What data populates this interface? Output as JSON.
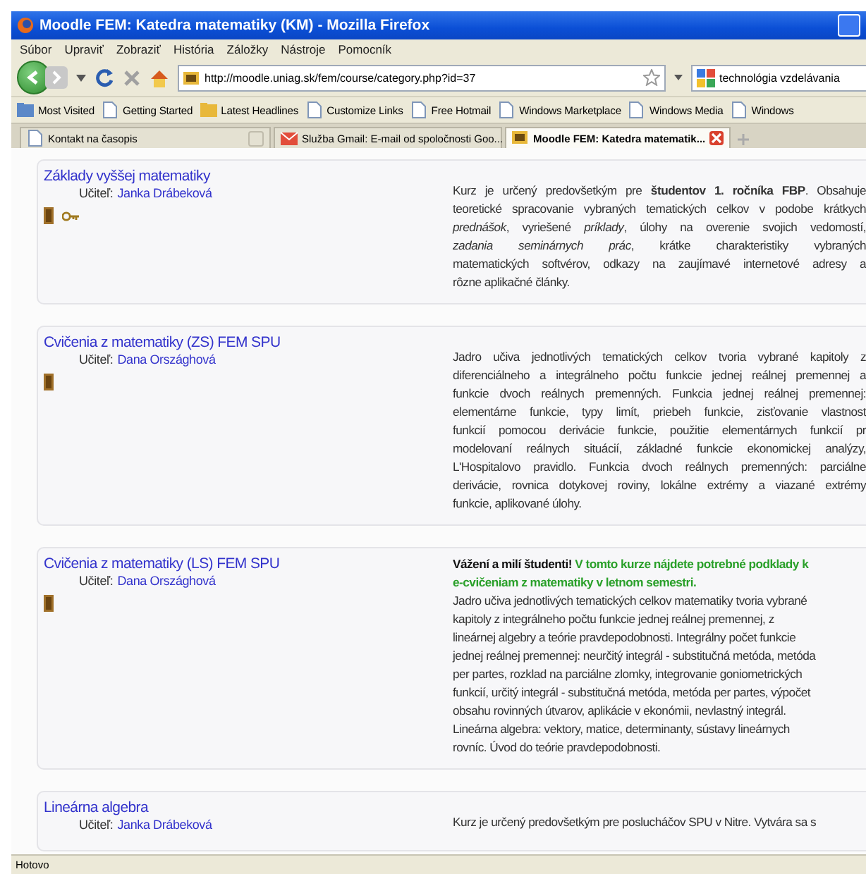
{
  "window": {
    "title": "Moodle FEM: Katedra matematiky (KM) - Mozilla Firefox"
  },
  "menu": [
    "Súbor",
    "Upraviť",
    "Zobraziť",
    "História",
    "Záložky",
    "Nástroje",
    "Pomocník"
  ],
  "address_bar": {
    "value": "http://moodle.uniag.sk/fem/course/category.php?id=37"
  },
  "search": {
    "value": "technológia vzdelávania"
  },
  "bookmarks": [
    {
      "label": "Most Visited",
      "kind": "folder"
    },
    {
      "label": "Getting Started",
      "kind": "page"
    },
    {
      "label": "Latest Headlines",
      "kind": "feed"
    },
    {
      "label": "Customize Links",
      "kind": "page"
    },
    {
      "label": "Free Hotmail",
      "kind": "page"
    },
    {
      "label": "Windows Marketplace",
      "kind": "page"
    },
    {
      "label": "Windows Media",
      "kind": "page"
    },
    {
      "label": "Windows",
      "kind": "page"
    }
  ],
  "tabs": [
    {
      "label": "Kontakt na časopis",
      "selected": false,
      "kind": "page"
    },
    {
      "label": "Služba Gmail: E-mail od spoločnosti Goo...",
      "selected": false,
      "kind": "gmail"
    },
    {
      "label": "Moodle FEM: Katedra matematik...",
      "selected": true,
      "kind": "moodle"
    }
  ],
  "courses": [
    {
      "title": "Základy vyššej matematiky",
      "teacher_label": "Učiteľ:",
      "teacher": "Janka Drábeková",
      "key_required": true,
      "justified": true,
      "lines": [
        "Kurz je určený predovšetkým pre **študentov 1. ročníka FBP**. Obsahuje",
        "teoretické spracovanie vybraných tematických celkov v podobe krátkych",
        "*prednášok*, vyriešené *príklady*, úlohy na overenie svojich vedomostí,",
        "*zadania seminárnych prác*, krátke charakteristiky vybraných",
        "matematických softvérov, odkazy na zaujímavé internetové adresy a",
        "rôzne aplikačné články."
      ]
    },
    {
      "title": "Cvičenia z matematiky (ZS) FEM SPU",
      "teacher_label": "Učiteľ:",
      "teacher": "Dana Országhová",
      "key_required": false,
      "justified": true,
      "lines": [
        "Jadro učiva jednotlivých tematických celkov tvoria vybrané kapitoly z",
        "diferenciálneho a integrálneho počtu funkcie jednej reálnej premennej a",
        "funkcie dvoch reálnych premenných. Funkcia jednej reálnej premennej:",
        "elementárne funkcie, typy limít, priebeh funkcie, zisťovanie vlastnost",
        "funkcií pomocou derivácie funkcie, použitie elementárnych funkcií pr",
        "modelovaní reálnych situácií, základné funkcie ekonomickej analýzy,",
        "L'Hospitalovo pravidlo. Funkcia dvoch reálnych premenných: parciálne",
        "derivácie, rovnica dotykovej roviny, lokálne extrémy a viazané extrémy",
        "funkcie, aplikované úlohy."
      ]
    },
    {
      "title": "Cvičenia z matematiky (LS) FEM SPU",
      "teacher_label": "Učiteľ:",
      "teacher": "Dana Országhová",
      "key_required": false,
      "justified": false,
      "notice": {
        "greeting": "Vážení a milí študenti!",
        "message": [
          "V tomto kurze nájdete potrebné podklady k",
          "e-cvičeniam z matematiky v letnom semestri."
        ]
      },
      "lines": [
        "Jadro učiva jednotlivých tematických celkov matematiky tvoria vybrané",
        "kapitoly z integrálneho počtu funkcie jednej reálnej premennej, z",
        "lineárnej algebry a teórie pravdepodobnosti. Integrálny počet funkcie",
        "jednej reálnej premennej: neurčitý integrál - substitučná metóda, metóda",
        "per partes, rozklad na parciálne zlomky, integrovanie goniometrických",
        "funkcií, určitý integrál - substitučná metóda, metóda per partes, výpočet",
        "obsahu rovinných útvarov, aplikácie v ekonómii, nevlastný integrál.",
        "Lineárna algebra: vektory, matice, determinanty, sústavy lineárnych",
        "rovníc. Úvod do teórie pravdepodobnosti."
      ]
    },
    {
      "title": "Lineárna algebra",
      "teacher_label": "Učiteľ:",
      "teacher": "Janka Drábeková",
      "lines": [
        "Kurz je určený predovšetkým pre poslucháčov SPU v Nitre. Vytvára sa s"
      ]
    }
  ],
  "status_bar": {
    "text": "Hotovo"
  }
}
